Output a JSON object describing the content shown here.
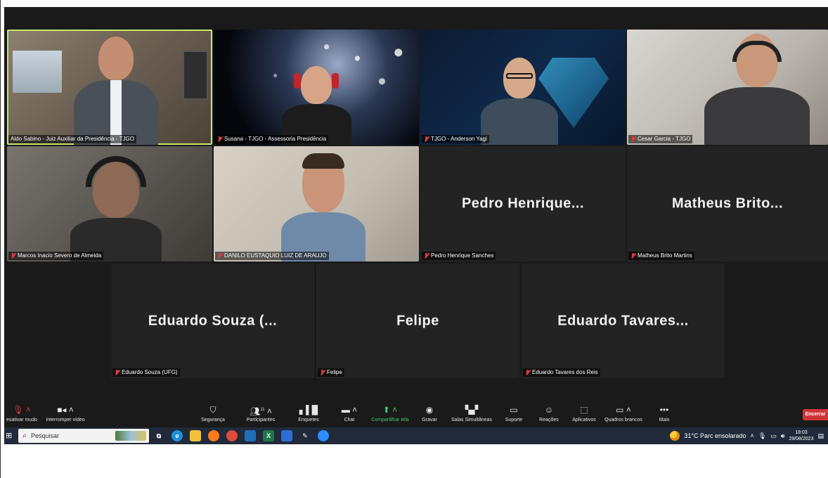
{
  "tiles": [
    {
      "name": "Aldo Sabino - Juiz Auxiliar da Presidência - TJGO",
      "display": ""
    },
    {
      "name": "Susana - TJGO - Assessoria Presidência",
      "display": ""
    },
    {
      "name": "TJGO - Anderson Yagi",
      "display": ""
    },
    {
      "name": "Cesar Garcia - TJGO",
      "display": ""
    },
    {
      "name": "Marcos Inacio Severo de Almeida",
      "display": ""
    },
    {
      "name": "DANILO EUSTAQUIO LUIZ DE ARAUJO",
      "display": ""
    },
    {
      "name": "Pedro Henrique Sanches",
      "display": "Pedro Henrique..."
    },
    {
      "name": "Matheus Brito Martins",
      "display": "Matheus Brito..."
    },
    {
      "name": "Eduardo Souza (UFG)",
      "display": "Eduardo Souza (..."
    },
    {
      "name": "Felipe",
      "display": "Felipe"
    },
    {
      "name": "Eduardo Tavares dos Reis",
      "display": "Eduardo Tavares..."
    }
  ],
  "toolbar": {
    "mute": "esativar mudo",
    "video": "Interromper vídeo",
    "security": "Segurança",
    "participants": "Participantes",
    "participants_count": "11",
    "polls": "Enquetes",
    "chat": "Chat",
    "share": "Compartilhar tela",
    "record": "Gravar",
    "breakout": "Salas Simultâneas",
    "support": "Suporte",
    "reactions": "Reações",
    "apps": "Aplicativos",
    "whiteboards": "Quadros brancos",
    "more": "Mais",
    "end": "Encerrar"
  },
  "taskbar": {
    "search_placeholder": "Pesquisar",
    "weather": "31°C  Parc ensolarado",
    "time": "18:03",
    "date": "29/08/2023"
  },
  "colors": {
    "active_speaker": "#c7e86b",
    "share_green": "#3ed06c",
    "end_red": "#d13438",
    "mute_red": "#e03a3a"
  }
}
